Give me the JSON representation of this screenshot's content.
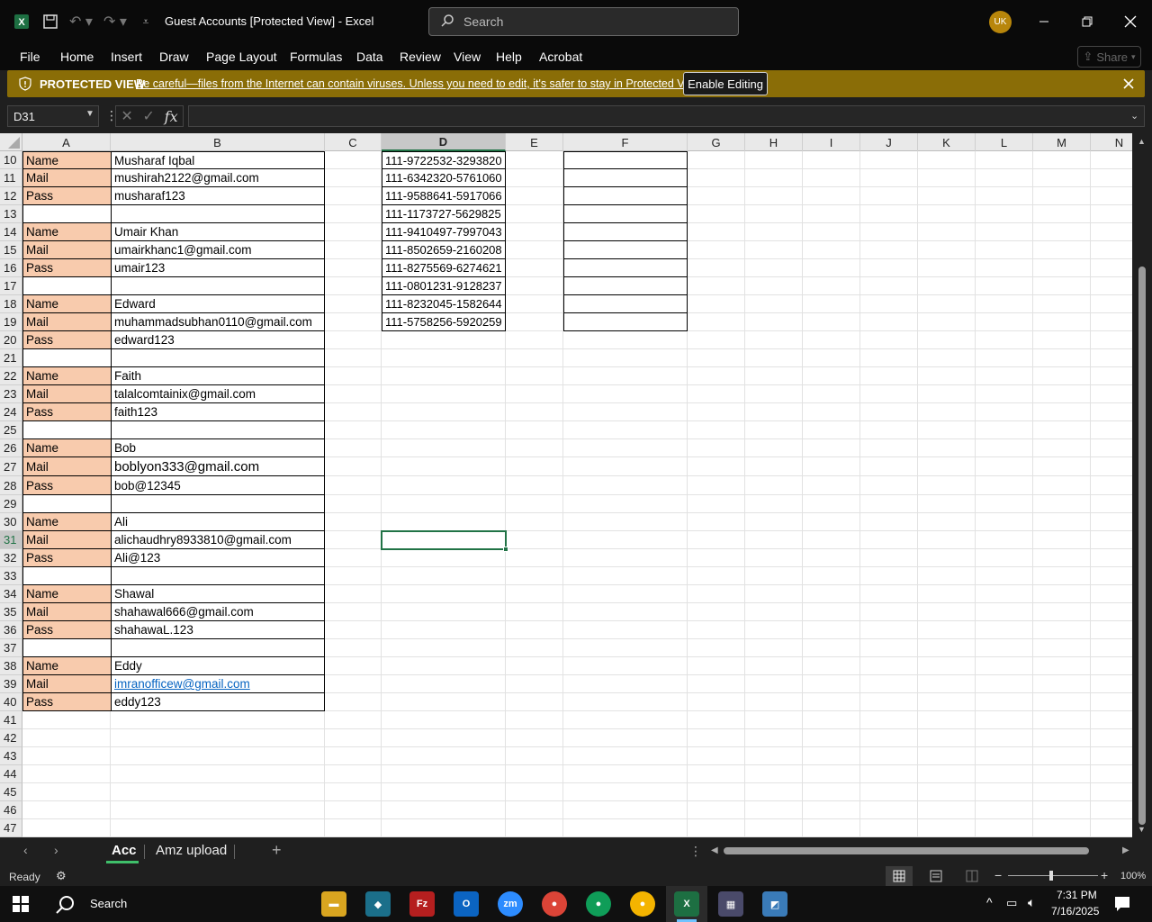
{
  "window": {
    "title": "Guest Accounts  [Protected View]  -  Excel",
    "search_placeholder": "Search",
    "avatar_initials": "UK"
  },
  "menu": [
    "File",
    "Home",
    "Insert",
    "Draw",
    "Page Layout",
    "Formulas",
    "Data",
    "Review",
    "View",
    "Help",
    "Acrobat"
  ],
  "share_label": "Share",
  "protected": {
    "title": "PROTECTED VIEW",
    "message": "Be careful—files from the Internet can contain viruses. Unless you need to edit, it's safer to stay in Protected View.",
    "enable_label": "Enable Editing"
  },
  "formula": {
    "name_box": "D31",
    "fx": "fx",
    "value": ""
  },
  "columns": [
    "A",
    "B",
    "C",
    "D",
    "E",
    "F",
    "G",
    "H",
    "I",
    "J",
    "K",
    "L",
    "M",
    "N"
  ],
  "selected_column": "D",
  "rows": [
    10,
    11,
    12,
    13,
    14,
    15,
    16,
    17,
    18,
    19,
    20,
    21,
    22,
    23,
    24,
    25,
    26,
    27,
    28,
    29,
    30,
    31,
    32,
    33,
    34,
    35,
    36,
    37,
    38,
    39,
    40,
    41,
    42,
    43,
    44,
    45,
    46,
    47
  ],
  "selected_row": 31,
  "records": [
    {
      "row": 10,
      "label": "Name",
      "value": "Musharaf Iqbal"
    },
    {
      "row": 11,
      "label": "Mail",
      "value": "mushirah2122@gmail.com"
    },
    {
      "row": 12,
      "label": "Pass",
      "value": "musharaf123"
    },
    {
      "row": 13,
      "label": "",
      "value": ""
    },
    {
      "row": 14,
      "label": "Name",
      "value": "Umair Khan"
    },
    {
      "row": 15,
      "label": "Mail",
      "value": "umairkhanc1@gmail.com"
    },
    {
      "row": 16,
      "label": "Pass",
      "value": "umair123"
    },
    {
      "row": 17,
      "label": "",
      "value": ""
    },
    {
      "row": 18,
      "label": "Name",
      "value": "Edward"
    },
    {
      "row": 19,
      "label": "Mail",
      "value": "muhammadsubhan0110@gmail.com"
    },
    {
      "row": 20,
      "label": "Pass",
      "value": "edward123"
    },
    {
      "row": 21,
      "label": "",
      "value": ""
    },
    {
      "row": 22,
      "label": "Name",
      "value": "Faith"
    },
    {
      "row": 23,
      "label": "Mail",
      "value": "talalcomtainix@gmail.com"
    },
    {
      "row": 24,
      "label": "Pass",
      "value": "faith123"
    },
    {
      "row": 25,
      "label": "",
      "value": ""
    },
    {
      "row": 26,
      "label": "Name",
      "value": "Bob"
    },
    {
      "row": 27,
      "label": "Mail",
      "value": "boblyon333@gmail.com"
    },
    {
      "row": 28,
      "label": "Pass",
      "value": "bob@12345"
    },
    {
      "row": 29,
      "label": "",
      "value": ""
    },
    {
      "row": 30,
      "label": "Name",
      "value": "Ali"
    },
    {
      "row": 31,
      "label": "Mail",
      "value": "alichaudhry8933810@gmail.com"
    },
    {
      "row": 32,
      "label": "Pass",
      "value": "Ali@123"
    },
    {
      "row": 33,
      "label": "",
      "value": ""
    },
    {
      "row": 34,
      "label": "Name",
      "value": "Shawal"
    },
    {
      "row": 35,
      "label": "Mail",
      "value": "shahawal666@gmail.com"
    },
    {
      "row": 36,
      "label": "Pass",
      "value": "shahawaL.123"
    },
    {
      "row": 37,
      "label": "",
      "value": ""
    },
    {
      "row": 38,
      "label": "Name",
      "value": "Eddy"
    },
    {
      "row": 39,
      "label": "Mail",
      "value": "imranofficew@gmail.com",
      "link": true
    },
    {
      "row": 40,
      "label": "Pass",
      "value": "eddy123"
    }
  ],
  "phones": [
    "111-9722532-3293820",
    "111-6342320-5761060",
    "111-9588641-5917066",
    "111-1173727-5629825",
    "111-9410497-7997043",
    "111-8502659-2160208",
    "111-8275569-6274621",
    "111-0801231-9128237",
    "111-8232045-1582644",
    "111-5758256-5920259"
  ],
  "sheets": [
    {
      "name": "Acc",
      "active": true
    },
    {
      "name": "Amz upload",
      "active": false
    }
  ],
  "status": {
    "ready": "Ready",
    "zoom": "100%"
  },
  "taskbar": {
    "search": "Search",
    "time": "7:31 PM",
    "date": "7/16/2025"
  },
  "colors": {
    "label_fill": "#f8cbad",
    "protected_bar": "#8a6d07",
    "excel_green": "#217346"
  }
}
